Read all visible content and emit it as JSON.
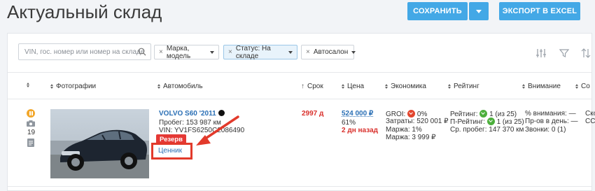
{
  "header": {
    "title": "Актуальный склад",
    "save_label": "СОХРАНИТЬ",
    "excel_label": "ЭКСПОРТ В EXCEL"
  },
  "filters": {
    "search_placeholder": "VIN, гос. номер или номер на складе",
    "brand_model": "Марка, модель",
    "status": "Статус: На складе",
    "dealer": "Автосалон"
  },
  "columns": {
    "photos": "Фотографии",
    "car": "Автомобиль",
    "term": "Срок",
    "price": "Цена",
    "economy": "Экономика",
    "rating": "Рейтинг",
    "attention": "Внимание",
    "cut": "Со"
  },
  "row": {
    "photo_count": "19",
    "car_title": "VOLVO S60 '2011",
    "mileage": "Пробег: 153 987 км",
    "vin": "VIN: YV1FS6250C2086490",
    "reserve_badge": "Резерв",
    "price_tag": "Ценник",
    "term": "2997 д",
    "price": "524 000 ₽",
    "price_pct": "61%",
    "price_updated": "2 дн назад",
    "groi_label": "GROI:",
    "groi_value": "0%",
    "costs": "Затраты: 520 001 ₽",
    "margin_pct": "Маржа: 1%",
    "margin": "Маржа: 3 999 ₽",
    "rating_label": "Рейтинг:",
    "rating_value": "1 (из 25)",
    "p_rating_label": "П-Рейтинг:",
    "p_rating_value": "1 (из 25)",
    "avg_mileage": "Ср. пробег: 147 370 км",
    "attention_pct": "% внимания: —",
    "views_day": "Пр-ов в день: —",
    "calls": "Звонки:  0 (1)",
    "next_col_1": "Ско",
    "next_col_2": "ССГ"
  },
  "colors": {
    "accent": "#43a8e6",
    "danger": "#e53935",
    "link": "#2a6fb5",
    "highlight_frame": "#e23a2b"
  }
}
